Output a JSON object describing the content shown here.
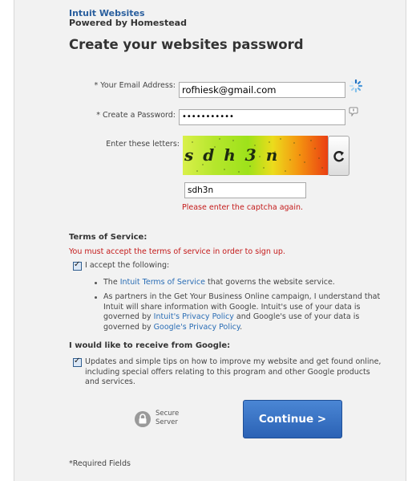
{
  "brand": {
    "name": "Intuit Websites",
    "powered_by": "Powered by Homestead"
  },
  "page_title": "Create your websites password",
  "form": {
    "email_label": "* Your Email Address:",
    "email_value": "rofhiesk@gmail.com",
    "password_label": "* Create a Password:",
    "password_value": "•••••••••••",
    "captcha_label": "Enter these letters:",
    "captcha_image_text": "sdh3n",
    "captcha_value": "sdh3n",
    "captcha_error": "Please enter the captcha again."
  },
  "terms": {
    "heading": "Terms of Service:",
    "error": "You must accept the terms of service in order to sign up.",
    "accept_checked": true,
    "accept_label": "I accept the following:",
    "b1_pre": "The ",
    "b1_link": "Intuit Terms of Service",
    "b1_post": " that governs the website service.",
    "b2_line1": "As partners in the Get Your Business Online campaign, I understand that",
    "b2_line2": "Intuit will share information with Google. Intuit's use of your data is",
    "b2_line3_pre": "governed by ",
    "b2_line3_link": "Intuit's Privacy Policy",
    "b2_line3_post": " and Google's use of your data is",
    "b2_line4_pre": "governed by ",
    "b2_line4_link": "Google's Privacy Policy",
    "b2_line4_post": "."
  },
  "google": {
    "heading": "I would like to receive from Google:",
    "updates_checked": true,
    "line1": "Updates and simple tips on how to improve my website and get found online,",
    "line2": "including special offers relating to this program and other Google products",
    "line3": "and services."
  },
  "secure": {
    "line1": "Secure",
    "line2": "Server"
  },
  "continue_label": "Continue >",
  "required_note": "*Required Fields",
  "colors": {
    "link": "#2a6db5",
    "error": "#c41a1a",
    "button": "#2b62b5",
    "brand": "#2a5f9e"
  },
  "icons": {
    "email_status": "loading-spinner-icon",
    "password_info": "info-bubble-icon",
    "captcha_refresh": "refresh-icon",
    "secure": "lock-icon"
  }
}
